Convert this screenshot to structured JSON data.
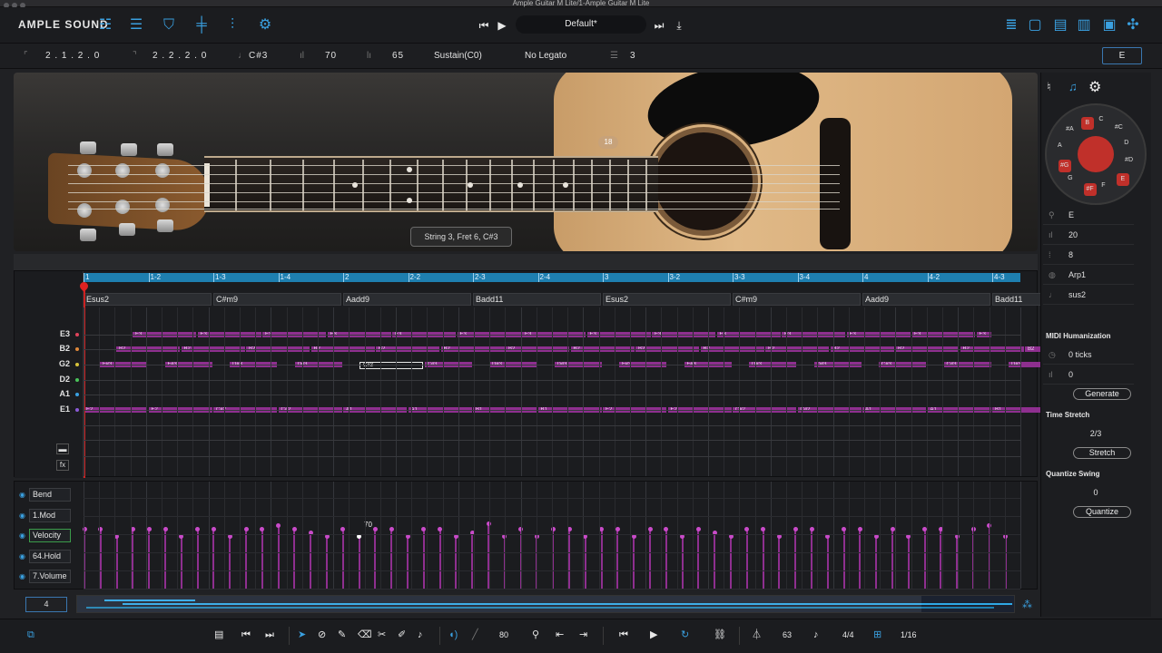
{
  "window": {
    "title": "Ample Guitar M Lite/1-Ample Guitar M Lite"
  },
  "topbar": {
    "logo": "AMPLE SOUND",
    "preset": "Default*"
  },
  "infobar": {
    "pos1": "2 . 1 . 2 . 0",
    "pos2": "2 . 2 . 2 . 0",
    "note": "C#3",
    "velocity": "70",
    "length": "65",
    "sustain": "Sustain(C0)",
    "legato": "No Legato",
    "string": "3",
    "key": "E"
  },
  "guitar": {
    "fret_marker": "18",
    "tooltip": "String 3, Fret 6, C#3"
  },
  "ruler": {
    "marks": [
      "1",
      "1-2",
      "1-3",
      "1-4",
      "2",
      "2-2",
      "2-3",
      "2-4",
      "3",
      "3-2",
      "3-3",
      "3-4",
      "4",
      "4-2",
      "4-3"
    ]
  },
  "chords": [
    "Esus2",
    "C#m9",
    "Aadd9",
    "Badd11",
    "Esus2",
    "C#m9",
    "Aadd9",
    "Badd11"
  ],
  "strings": [
    {
      "label": "E3",
      "color": "#e0435a"
    },
    {
      "label": "B2",
      "color": "#e0883a"
    },
    {
      "label": "G2",
      "color": "#d6c23a"
    },
    {
      "label": "D2",
      "color": "#4ac45a"
    },
    {
      "label": "A1",
      "color": "#3aa0e0"
    },
    {
      "label": "E1",
      "color": "#8a5ad6"
    }
  ],
  "notes": {
    "e3": "E3",
    "b2": "B2",
    "g2": [
      "F#3",
      "F#3",
      "D#3",
      "D#3",
      "C#3",
      "C#3",
      "D#3",
      "D#3",
      "F#3",
      "F#3",
      "D#3",
      "D#3",
      "C#3",
      "C#3",
      "D#3"
    ],
    "e1": [
      "E2",
      "E2",
      "C#2",
      "C#2",
      "A1",
      "A1",
      "B1",
      "B1",
      "E2",
      "E2",
      "C#2",
      "C#2",
      "A1",
      "A1",
      "B1"
    ]
  },
  "cc": {
    "lanes": [
      "Bend",
      "1.Mod",
      "Velocity",
      "64.Hold",
      "7.Volume"
    ],
    "velocity_label": "70"
  },
  "overview": {
    "measure": "4"
  },
  "sidebar": {
    "key": "E",
    "val1": "20",
    "val2": "8",
    "arp": "Arp1",
    "chord_type": "sus2",
    "midi_h_title": "MIDI Humanization",
    "ticks": "0 ticks",
    "hum_vel": "0",
    "generate": "Generate",
    "ts_title": "Time Stretch",
    "ts_val": "2/3",
    "stretch": "Stretch",
    "qs_title": "Quantize Swing",
    "qs_val": "0",
    "quantize": "Quantize",
    "dial_keys": [
      "B",
      "C",
      "#C",
      "D",
      "#D",
      "E",
      "F",
      "#F",
      "G",
      "#G",
      "A",
      "#A"
    ]
  },
  "bottom": {
    "vel": "80",
    "tempo": "63",
    "sig": "4/4",
    "grid": "1/16"
  }
}
